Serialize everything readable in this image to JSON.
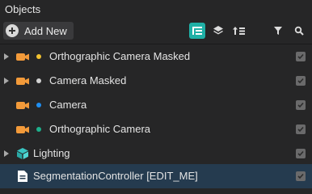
{
  "panel": {
    "title": "Objects"
  },
  "toolbar": {
    "add_new_label": "Add New",
    "buttons": [
      {
        "icon": "hierarchy-list-icon",
        "active": true
      },
      {
        "icon": "layers-icon",
        "active": false
      },
      {
        "icon": "sort-list-icon",
        "active": false
      },
      {
        "icon": "filter-icon",
        "active": false
      },
      {
        "icon": "search-icon",
        "active": false
      }
    ]
  },
  "colors": {
    "accent": "#1fb0a6",
    "camera_icon": "#f29a3a",
    "lighting_icon": "#39c5c2",
    "selected_row": "#253b4f",
    "layer_yellow": "#f2c230",
    "layer_white": "#d2d2d2",
    "layer_blue": "#1f8ff2",
    "layer_green": "#1db08c"
  },
  "objects": [
    {
      "label": "Orthographic Camera Masked",
      "icon": "camera-icon",
      "expandable": true,
      "layer_color": "#f2c230",
      "checked": true,
      "selected": false
    },
    {
      "label": "Camera Masked",
      "icon": "camera-icon",
      "expandable": true,
      "layer_color": "#d2d2d2",
      "checked": true,
      "selected": false
    },
    {
      "label": "Camera",
      "icon": "camera-icon",
      "expandable": false,
      "layer_color": "#1f8ff2",
      "checked": true,
      "selected": false
    },
    {
      "label": "Orthographic Camera",
      "icon": "camera-icon",
      "expandable": false,
      "layer_color": "#1db08c",
      "checked": true,
      "selected": false
    },
    {
      "label": "Lighting",
      "icon": "lighting-icon",
      "expandable": true,
      "layer_color": null,
      "checked": true,
      "selected": false
    },
    {
      "label": "SegmentationController [EDIT_ME]",
      "icon": "script-icon",
      "expandable": false,
      "layer_color": null,
      "checked": true,
      "selected": true
    }
  ]
}
